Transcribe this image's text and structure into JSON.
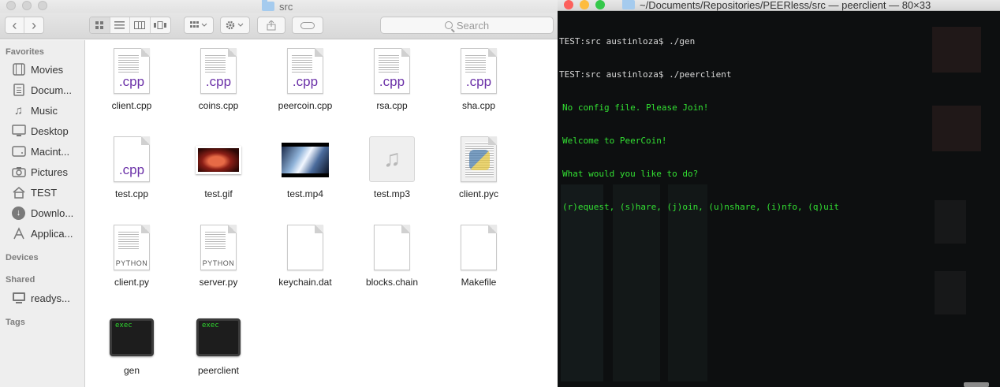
{
  "finder": {
    "window_title": "src",
    "toolbar": {
      "back_glyph": "‹",
      "forward_glyph": "›",
      "search_placeholder": "Search"
    },
    "sidebar": {
      "sections": {
        "favorites": "Favorites",
        "devices": "Devices",
        "shared": "Shared",
        "tags": "Tags"
      },
      "favorites": [
        {
          "label": "Movies",
          "icon": "film-icon"
        },
        {
          "label": "Docum...",
          "icon": "documents-icon"
        },
        {
          "label": "Music",
          "icon": "music-note-icon"
        },
        {
          "label": "Desktop",
          "icon": "desktop-icon"
        },
        {
          "label": "Macint...",
          "icon": "drive-icon"
        },
        {
          "label": "Pictures",
          "icon": "camera-icon"
        },
        {
          "label": "TEST",
          "icon": "home-icon"
        },
        {
          "label": "Downlo...",
          "icon": "download-icon"
        },
        {
          "label": "Applica...",
          "icon": "applications-icon"
        }
      ],
      "shared": [
        {
          "label": "readys...",
          "icon": "computer-icon"
        }
      ]
    },
    "files": [
      {
        "name": "client.cpp",
        "kind": "cpp",
        "badge": ".cpp"
      },
      {
        "name": "coins.cpp",
        "kind": "cpp",
        "badge": ".cpp"
      },
      {
        "name": "peercoin.cpp",
        "kind": "cpp",
        "badge": ".cpp"
      },
      {
        "name": "rsa.cpp",
        "kind": "cpp",
        "badge": ".cpp"
      },
      {
        "name": "sha.cpp",
        "kind": "cpp",
        "badge": ".cpp"
      },
      {
        "name": "test.cpp",
        "kind": "cpp",
        "badge": ".cpp"
      },
      {
        "name": "test.gif",
        "kind": "gif"
      },
      {
        "name": "test.mp4",
        "kind": "mp4"
      },
      {
        "name": "test.mp3",
        "kind": "mp3",
        "glyph": "♫"
      },
      {
        "name": "client.pyc",
        "kind": "pyc"
      },
      {
        "name": "client.py",
        "kind": "py",
        "badge": "PYTHON"
      },
      {
        "name": "server.py",
        "kind": "py",
        "badge": "PYTHON"
      },
      {
        "name": "keychain.dat",
        "kind": "blank"
      },
      {
        "name": "blocks.chain",
        "kind": "blank"
      },
      {
        "name": "Makefile",
        "kind": "blank"
      },
      {
        "name": "gen",
        "kind": "exec",
        "badge": "exec"
      },
      {
        "name": "peerclient",
        "kind": "exec",
        "badge": "exec"
      }
    ]
  },
  "terminal": {
    "window_title": "~/Documents/Repositories/PEERless/src — peerclient — 80×33",
    "lines": [
      {
        "text": "TEST:src austinloza$ ./gen",
        "style": "prompt"
      },
      {
        "text": "TEST:src austinloza$ ./peerclient",
        "style": "prompt"
      },
      {
        "text": "No config file. Please Join!",
        "style": "prog"
      },
      {
        "text": "Welcome to PeerCoin!",
        "style": "prog"
      },
      {
        "text": "What would you like to do?",
        "style": "prog"
      },
      {
        "text": "(r)equest, (s)hare, (j)oin, (u)nshare, (i)nfo, (q)uit",
        "style": "prog"
      }
    ]
  },
  "colors": {
    "terminal_green": "#33e033",
    "cpp_badge": "#6b31a8",
    "close_light": "#fc605c",
    "minimize_light": "#fdbc40",
    "zoom_light": "#34c84a"
  }
}
